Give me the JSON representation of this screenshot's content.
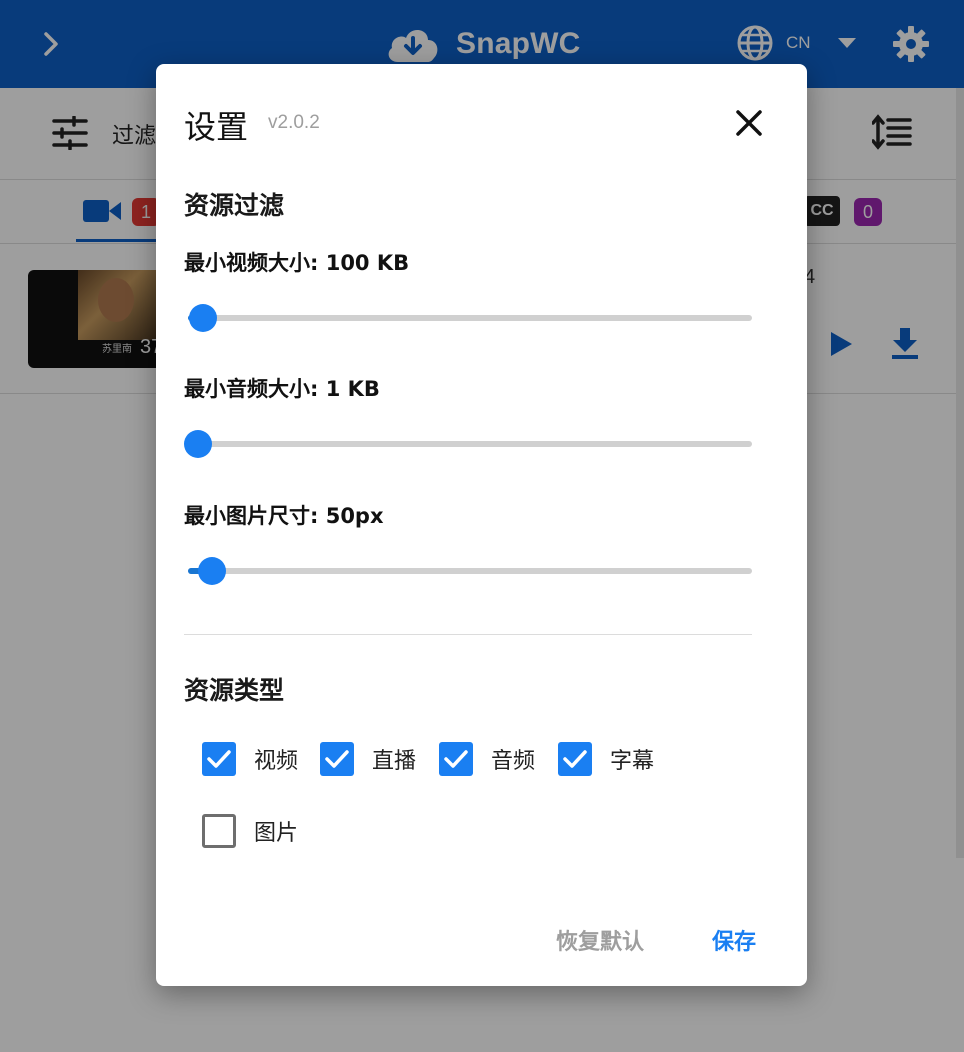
{
  "app": {
    "title": "SnapWC",
    "language": "CN",
    "toolbar": {
      "filter_label": "过滤"
    },
    "tabs": {
      "video_count": "1",
      "subtitle_count": "0",
      "subtitle_icon_text": "CC"
    },
    "row": {
      "thumb_caption": "苏里南",
      "duration": "37",
      "count": "4"
    }
  },
  "dialog": {
    "title": "设置",
    "version": "v2.0.2",
    "filter_section": "资源过滤",
    "sliders": [
      {
        "label": "最小视频大小: 100 KB",
        "value_fraction": 0.01
      },
      {
        "label": "最小音频大小: 1 KB",
        "value_fraction": 0.0
      },
      {
        "label": "最小图片尺寸: 50px",
        "value_fraction": 0.025
      }
    ],
    "type_section": "资源类型",
    "types": [
      {
        "label": "视频",
        "checked": true
      },
      {
        "label": "直播",
        "checked": true
      },
      {
        "label": "音频",
        "checked": true
      },
      {
        "label": "字幕",
        "checked": true
      },
      {
        "label": "图片",
        "checked": false
      }
    ],
    "reset_label": "恢复默认",
    "save_label": "保存"
  },
  "colors": {
    "primary": "#0d5fc7",
    "accent": "#1a7ff2",
    "badge_red": "#e53935",
    "badge_purple": "#9c27b0"
  }
}
